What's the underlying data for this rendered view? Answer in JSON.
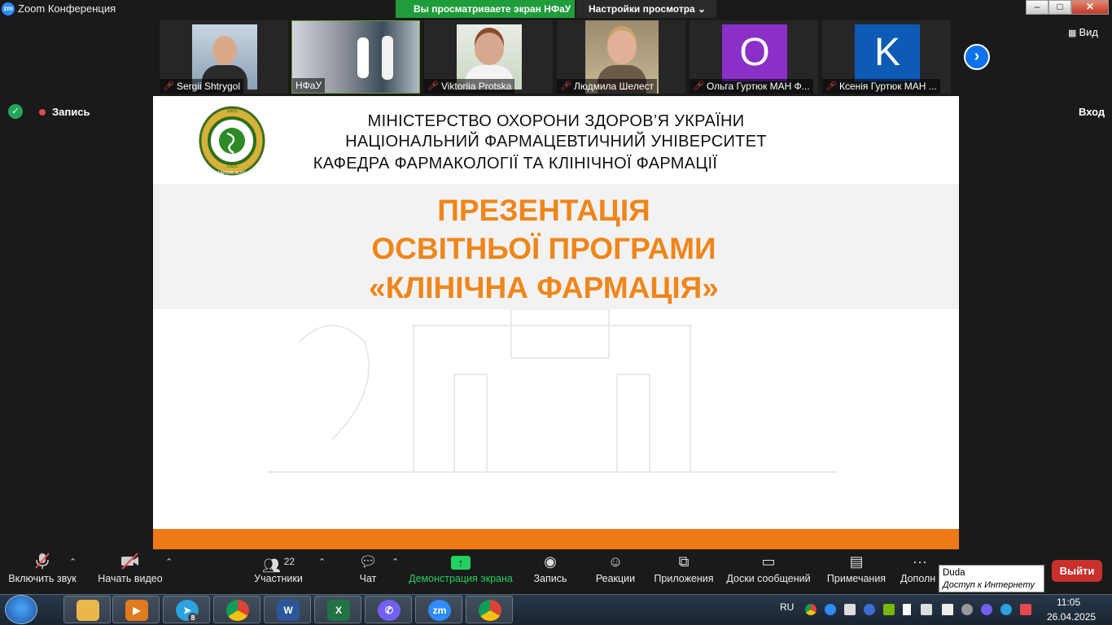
{
  "window": {
    "title": "Zoom Конференция",
    "app_icon_text": "zm",
    "minimize": "–",
    "maximize": "□",
    "close": "✕"
  },
  "banner": {
    "viewing": "Вы просматриваете экран НФаУ",
    "settings": "Настройки просмотра ⌄"
  },
  "participants_strip": [
    {
      "name": "Sergii Shtrygol",
      "muted": true,
      "avatar": ""
    },
    {
      "name": "НФаУ",
      "muted": false,
      "avatar": ""
    },
    {
      "name": "Viktoriia Protska",
      "muted": true,
      "avatar": ""
    },
    {
      "name": "Людмила Шелест",
      "muted": true,
      "avatar": ""
    },
    {
      "name": "Ольга Гуртюк МАН Ф...",
      "muted": true,
      "avatar": "O",
      "color": "#8b2fc9"
    },
    {
      "name": "Ксенія Гуртюк МАН ...",
      "muted": true,
      "avatar": "K",
      "color": "#0d5bb5"
    }
  ],
  "view_button": "Вид",
  "recording_label": "Запись",
  "enter_button": "Вход",
  "slide": {
    "header_line1": "МІНІСТЕРСТВО ОХОРОНИ ЗДОРОВ’Я УКРАЇНИ",
    "header_line2": "НАЦІОНАЛЬНИЙ ФАРМАЦЕВТИЧНИЙ УНІВЕРСИТЕТ",
    "header_line3": "КАФЕДРА ФАРМАКОЛОГІЇ ТА КЛІНІЧНОЇ ФАРМАЦІЇ",
    "title_line1": "ПРЕЗЕНТАЦІЯ",
    "title_line2": "ОСВІТНЬОЇ ПРОГРАМИ",
    "title_line3": "«КЛІНІЧНА ФАРМАЦІЯ»",
    "logo_top": "1805",
    "logo_mid": "1921",
    "logo_bottom": "SAPERE AUDE"
  },
  "toolbar": {
    "unmute": "Включить звук",
    "start_video": "Начать видео",
    "participants": "Участники",
    "participants_count": "22",
    "chat": "Чат",
    "share": "Демонстрация экрана",
    "record": "Запись",
    "reactions": "Реакции",
    "apps": "Приложения",
    "whiteboards": "Доски сообщений",
    "notes": "Примечания",
    "more": "Дополн",
    "leave": "Выйти"
  },
  "tooltip": {
    "title": "Duda",
    "subtitle": "Доступ к Интернету"
  },
  "taskbar": {
    "telegram_badge": "8",
    "lang": "RU",
    "time": "11:05",
    "date": "26.04.2025"
  },
  "colors": {
    "zoom_blue": "#0e72ed",
    "share_green": "#23d160",
    "slide_orange": "#f08519",
    "leave_red": "#c9302c"
  }
}
